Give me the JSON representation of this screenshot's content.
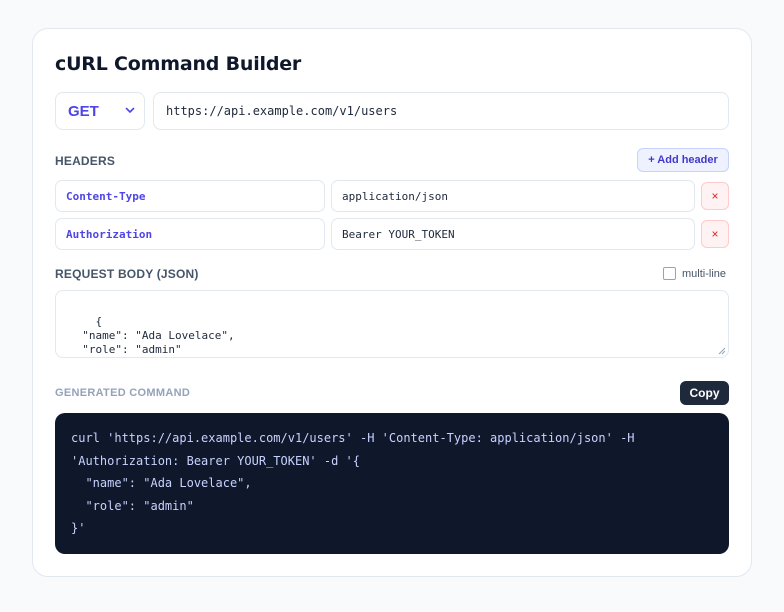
{
  "title": "cURL Command Builder",
  "request": {
    "method": "GET",
    "url": "https://api.example.com/v1/users"
  },
  "headers_section": {
    "label": "HEADERS",
    "add_label": "+ Add header",
    "rows": [
      {
        "key": "Content-Type",
        "value": "application/json",
        "remove": "×"
      },
      {
        "key": "Authorization",
        "value": "Bearer YOUR_TOKEN",
        "remove": "×"
      }
    ]
  },
  "body_section": {
    "label": "REQUEST BODY (JSON)",
    "multiline_label": "multi-line",
    "multiline_checked": false,
    "value": "{\n  \"name\": \"Ada Lovelace\",\n  \"role\": \"admin\"\n}"
  },
  "output": {
    "label": "GENERATED COMMAND",
    "copy_label": "Copy",
    "command": "curl 'https://api.example.com/v1/users' -H 'Content-Type: application/json' -H\n'Authorization: Bearer YOUR_TOKEN' -d '{\n  \"name\": \"Ada Lovelace\",\n  \"role\": \"admin\"\n}'"
  },
  "icons": {
    "method_dropdown": "chevron-down-icon",
    "remove_header": "close-icon",
    "textarea_resize": "resize-handle-icon"
  },
  "colors": {
    "accent": "#4f46e5",
    "danger": "#dc2626",
    "code_bg": "#0f172a",
    "button_dark": "#1e293b"
  }
}
